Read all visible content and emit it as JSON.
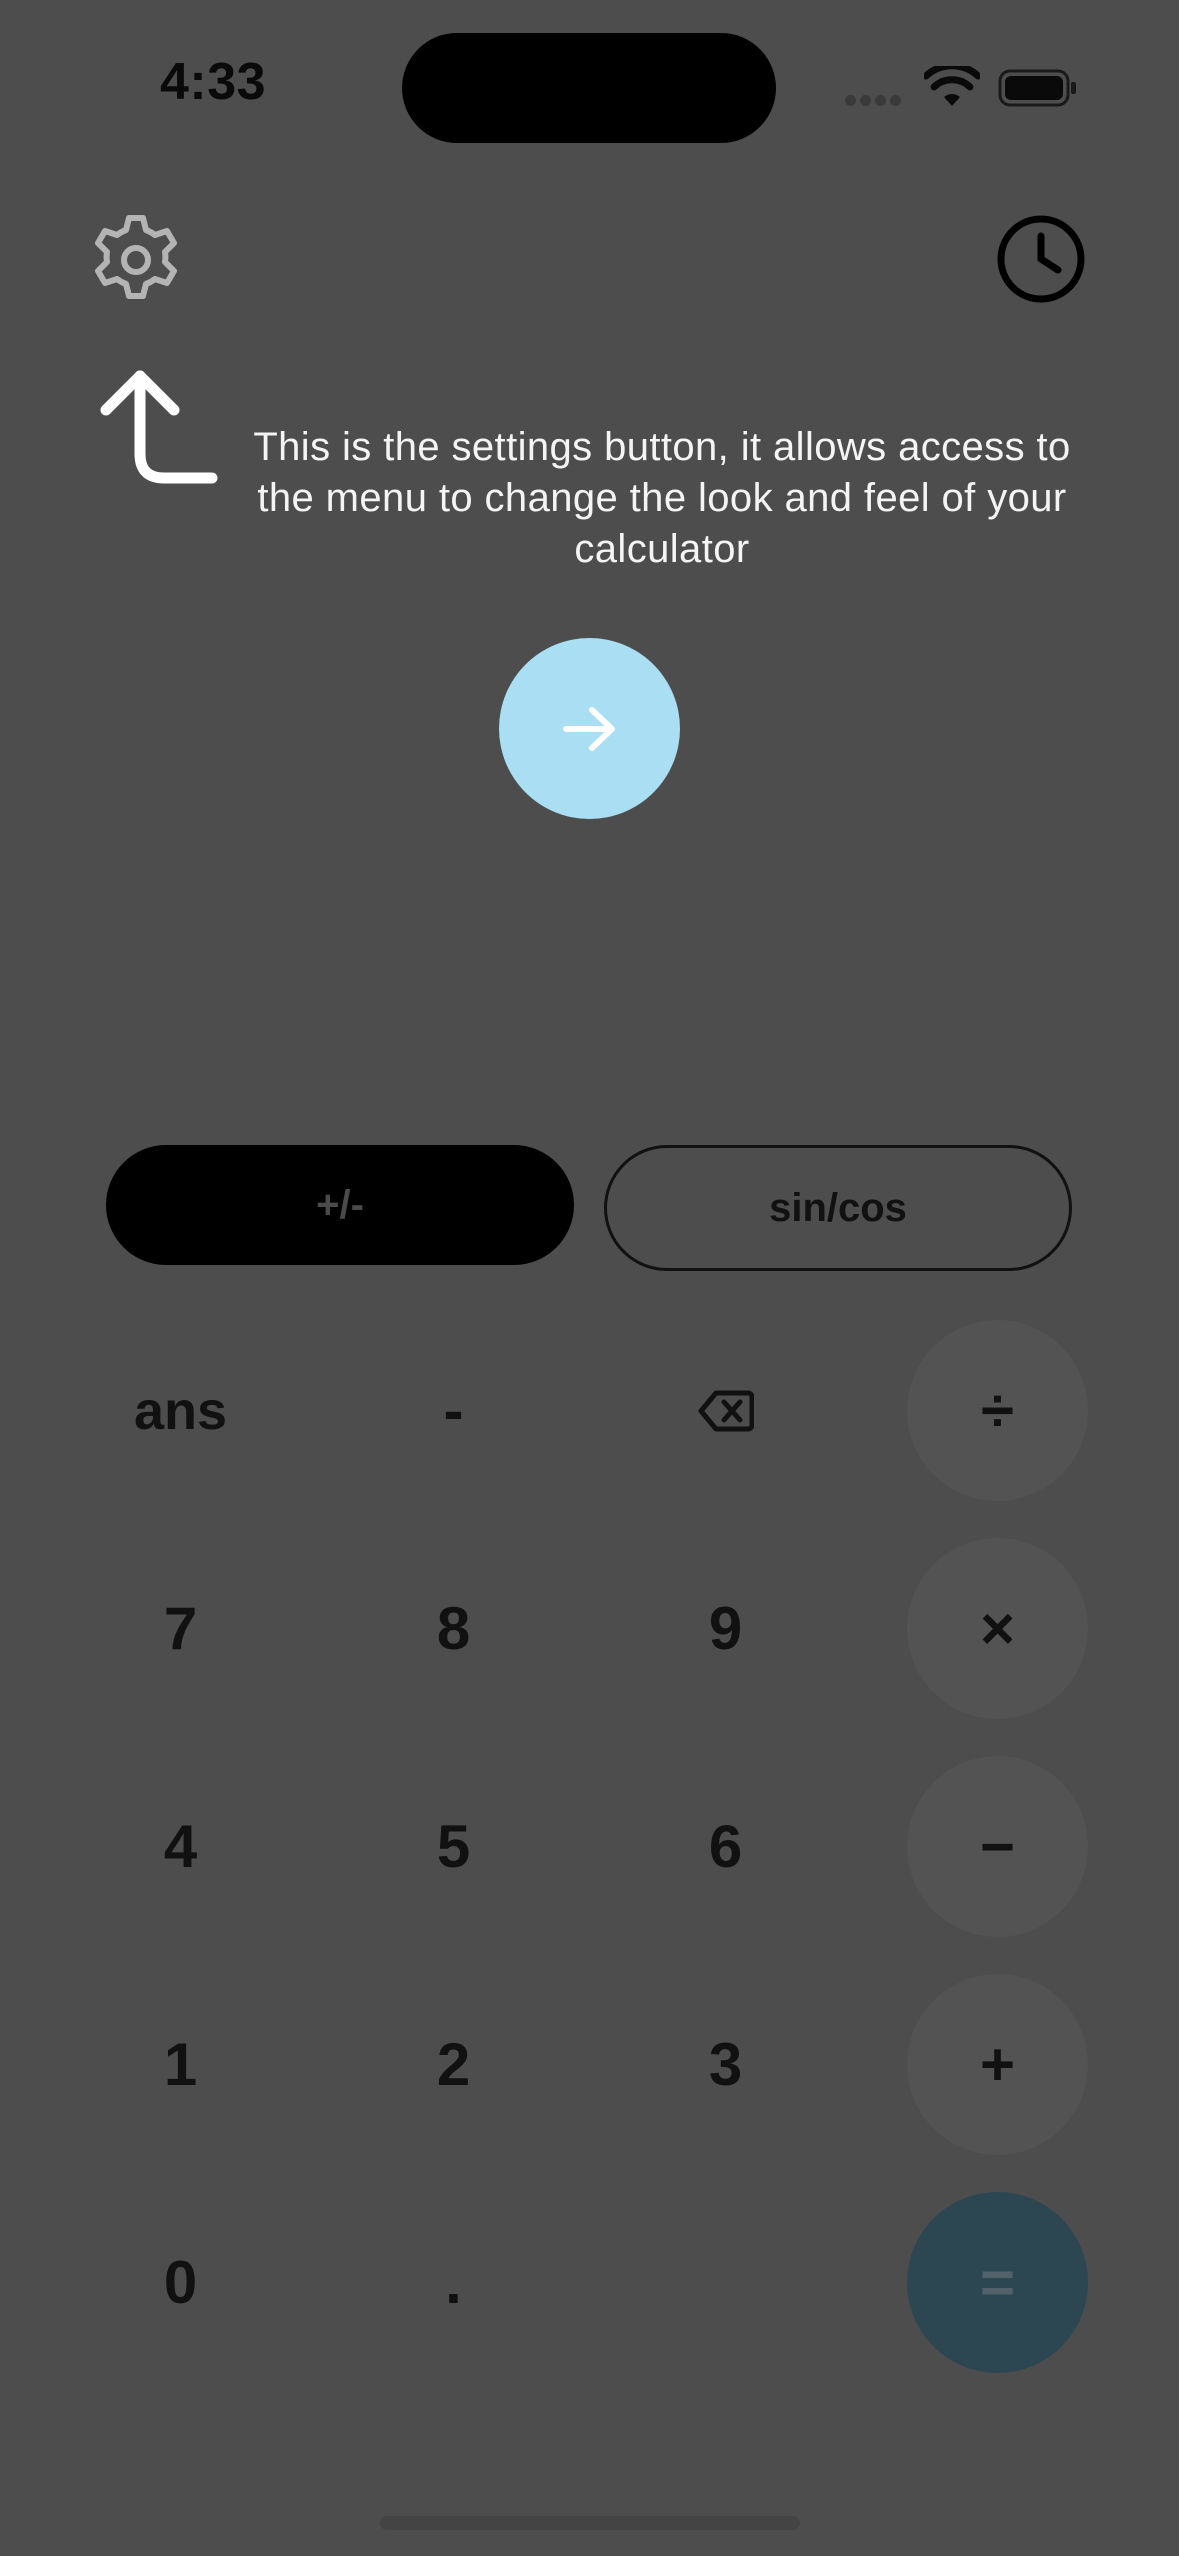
{
  "status_bar": {
    "time": "4:33"
  },
  "header": {
    "settings_icon": "gear-icon",
    "history_icon": "clock-icon"
  },
  "tutorial": {
    "message": "This is the settings button, it allows access to the menu to change the look and feel of your calculator",
    "pointer_icon": "arrow-up-left-icon",
    "next_icon": "arrow-right-icon",
    "next_color": "#a9def3"
  },
  "modes": {
    "negate_label": "+/-",
    "trig_label": "sin/cos"
  },
  "keypad": {
    "ans": "ans",
    "minus_sign": "-",
    "backspace_icon": "backspace-icon",
    "divide": "÷",
    "seven": "7",
    "eight": "8",
    "nine": "9",
    "multiply": "×",
    "four": "4",
    "five": "5",
    "six": "6",
    "subtract": "−",
    "one": "1",
    "two": "2",
    "three": "3",
    "add": "+",
    "zero": "0",
    "decimal": ".",
    "equals": "="
  },
  "colors": {
    "overlay_background": "#4d4d4d",
    "equals_button": "#2c4652"
  }
}
